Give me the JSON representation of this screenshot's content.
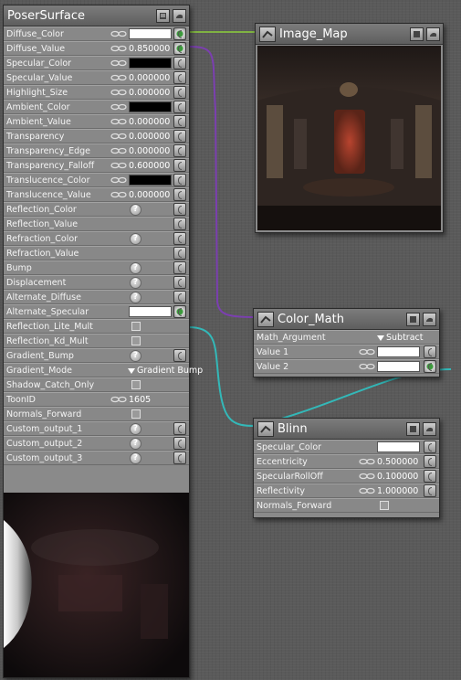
{
  "poser_surface": {
    "title": "PoserSurface",
    "rows": [
      {
        "label": "Diffuse_Color",
        "type": "color",
        "link": true,
        "color": "#ffffff",
        "connected": true
      },
      {
        "label": "Diffuse_Value",
        "type": "value",
        "link": true,
        "value": "0.850000",
        "connected": true
      },
      {
        "label": "Specular_Color",
        "type": "color",
        "link": true,
        "color": "#000000"
      },
      {
        "label": "Specular_Value",
        "type": "value",
        "link": true,
        "value": "0.000000"
      },
      {
        "label": "Highlight_Size",
        "type": "value",
        "link": true,
        "value": "0.000000"
      },
      {
        "label": "Ambient_Color",
        "type": "color",
        "link": true,
        "color": "#000000"
      },
      {
        "label": "Ambient_Value",
        "type": "value",
        "link": true,
        "value": "0.000000"
      },
      {
        "label": "Transparency",
        "type": "value",
        "link": true,
        "value": "0.000000"
      },
      {
        "label": "Transparency_Edge",
        "type": "value",
        "link": true,
        "value": "0.000000"
      },
      {
        "label": "Transparency_Falloff",
        "type": "value",
        "link": true,
        "value": "0.600000"
      },
      {
        "label": "Translucence_Color",
        "type": "color",
        "link": true,
        "color": "#000000"
      },
      {
        "label": "Translucence_Value",
        "type": "value",
        "link": true,
        "value": "0.000000"
      },
      {
        "label": "Reflection_Color",
        "type": "help"
      },
      {
        "label": "Reflection_Value",
        "type": "empty"
      },
      {
        "label": "Refraction_Color",
        "type": "help"
      },
      {
        "label": "Refraction_Value",
        "type": "empty"
      },
      {
        "label": "Bump",
        "type": "help"
      },
      {
        "label": "Displacement",
        "type": "help"
      },
      {
        "label": "Alternate_Diffuse",
        "type": "help"
      },
      {
        "label": "Alternate_Specular",
        "type": "color",
        "color": "#ffffff",
        "connected": true
      },
      {
        "label": "Reflection_Lite_Mult",
        "type": "check",
        "noplug": true
      },
      {
        "label": "Reflection_Kd_Mult",
        "type": "check",
        "noplug": true
      },
      {
        "label": "Gradient_Bump",
        "type": "help"
      },
      {
        "label": "Gradient_Mode",
        "type": "dropdown",
        "value": "Gradient Bump",
        "noplug": true
      },
      {
        "label": "Shadow_Catch_Only",
        "type": "check",
        "noplug": true
      },
      {
        "label": "ToonID",
        "type": "value",
        "link": true,
        "value": "1605",
        "noplug": true
      },
      {
        "label": "Normals_Forward",
        "type": "check",
        "noplug": true
      },
      {
        "label": "Custom_output_1",
        "type": "help"
      },
      {
        "label": "Custom_output_2",
        "type": "help"
      },
      {
        "label": "Custom_output_3",
        "type": "help"
      }
    ]
  },
  "image_map": {
    "title": "Image_Map"
  },
  "color_math": {
    "title": "Color_Math",
    "rows": [
      {
        "label": "Math_Argument",
        "type": "dropdown",
        "value": "Subtract",
        "noplug": true
      },
      {
        "label": "Value 1",
        "type": "color",
        "link": true,
        "color": "#ffffff"
      },
      {
        "label": "Value 2",
        "type": "color",
        "link": true,
        "color": "#ffffff",
        "connected": true
      }
    ]
  },
  "blinn": {
    "title": "Blinn",
    "rows": [
      {
        "label": "Specular_Color",
        "type": "color",
        "color": "#ffffff"
      },
      {
        "label": "Eccentricity",
        "type": "value",
        "link": true,
        "value": "0.500000"
      },
      {
        "label": "SpecularRollOff",
        "type": "value",
        "link": true,
        "value": "0.100000"
      },
      {
        "label": "Reflectivity",
        "type": "value",
        "link": true,
        "value": "1.000000"
      },
      {
        "label": "Normals_Forward",
        "type": "check",
        "noplug": true
      }
    ]
  },
  "colors": {
    "wire_green": "#8ccf3a",
    "wire_purple": "#7b3fb0",
    "wire_teal": "#33b8b8"
  }
}
